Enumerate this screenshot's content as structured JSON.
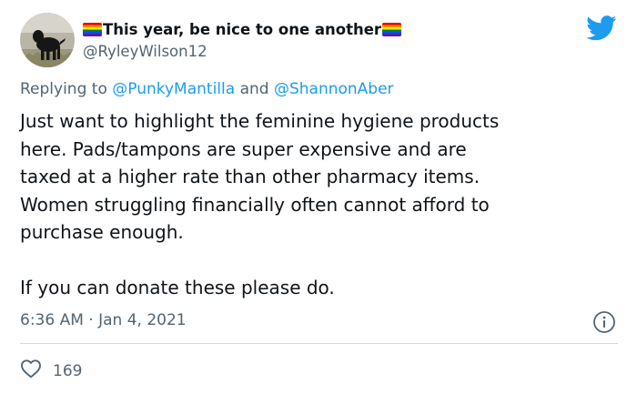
{
  "author": {
    "display_name": "This year, be nice to one another",
    "handle": "@RyleyWilson12",
    "left_icon": "rainbow-flag-icon",
    "right_icon": "rainbow-flag-icon",
    "avatar": "black-dog-avatar"
  },
  "reply_context": {
    "prefix": "Replying to",
    "mention_1": "@PunkyMantilla",
    "conjunction": "and",
    "mention_2": "@ShannonAber"
  },
  "tweet": {
    "lines": [
      "Just want to highlight the feminine hygiene products",
      "here. Pads/tampons are super expensive and are",
      "taxed at a higher rate than other pharmacy items.",
      "Women struggling financially often cannot afford to",
      "purchase enough."
    ],
    "closing": "If you can donate these please do.",
    "timestamp": "6:36 AM · Jan 4, 2021"
  },
  "stats": {
    "likes": "169"
  },
  "icons": {
    "brand": "twitter-bird-icon",
    "info": "info-icon",
    "like": "heart-icon"
  },
  "colors": {
    "text": "#0f1419",
    "secondary": "#536471",
    "accent": "#1d9bf0",
    "divider": "#cfd9de"
  }
}
